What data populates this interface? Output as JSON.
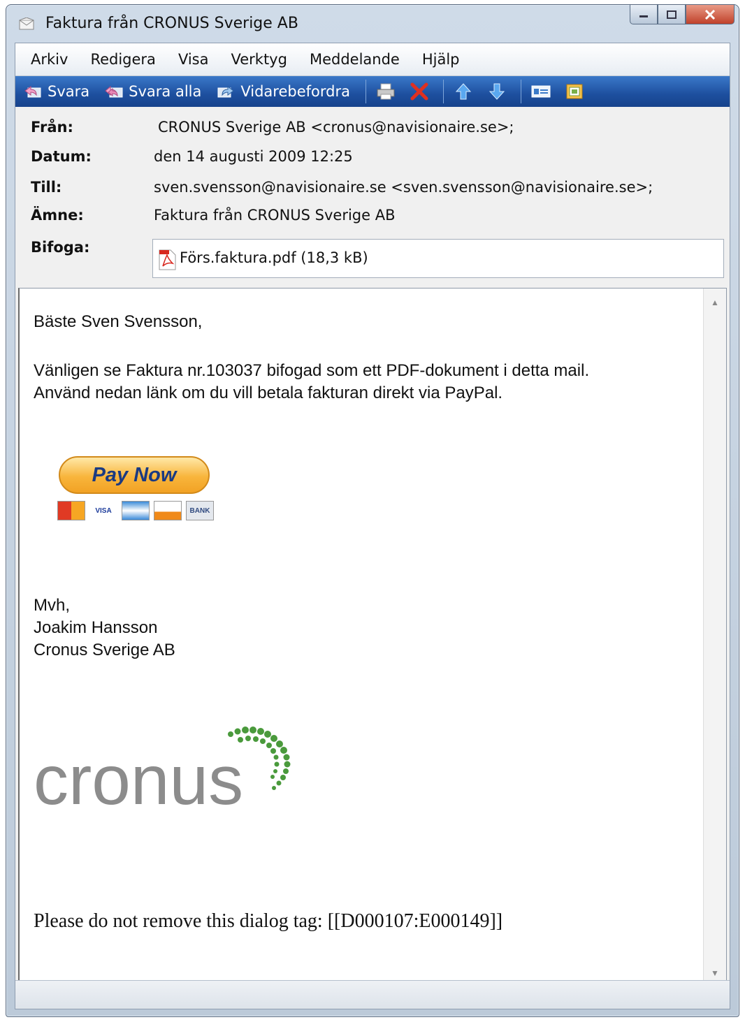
{
  "window": {
    "title": "Faktura från CRONUS Sverige AB"
  },
  "menu": [
    "Arkiv",
    "Redigera",
    "Visa",
    "Verktyg",
    "Meddelande",
    "Hjälp"
  ],
  "toolbar": {
    "reply": "Svara",
    "reply_all": "Svara alla",
    "forward": "Vidarebefordra"
  },
  "headers": {
    "from_label": "Från:",
    "from": "CRONUS Sverige AB  <cronus@navisionaire.se>;",
    "date_label": "Datum:",
    "date": "den 14 augusti 2009 12:25",
    "to_label": "Till:",
    "to": "sven.svensson@navisionaire.se <sven.svensson@navisionaire.se>;",
    "subject_label": "Ämne:",
    "subject": "Faktura från CRONUS Sverige AB",
    "attach_label": "Bifoga:",
    "attachment": "Förs.faktura.pdf (18,3 kB)"
  },
  "body": {
    "greeting": "Bäste Sven Svensson,",
    "line1": "Vänligen se Faktura nr.103037 bifogad som ett PDF-dokument i detta mail.",
    "line2": "Använd nedan länk om du vill betala fakturan direkt via PayPal.",
    "pay_button": "Pay Now",
    "cards": [
      "",
      "VISA",
      "",
      "",
      "BANK"
    ],
    "sign1": "Mvh,",
    "sign2": "Joakim Hansson",
    "sign3": "Cronus Sverige AB",
    "logo_text": "cronus",
    "dialog_tag": "Please do not remove this dialog tag: [[D000107:E000149]]"
  },
  "colors": {
    "toolbar": "#1d4f9e",
    "logo_gray": "#8c8c8c",
    "logo_green": "#4a9a3c",
    "paypal_orange": "#f8b53c",
    "paypal_text": "#1a3a82"
  }
}
